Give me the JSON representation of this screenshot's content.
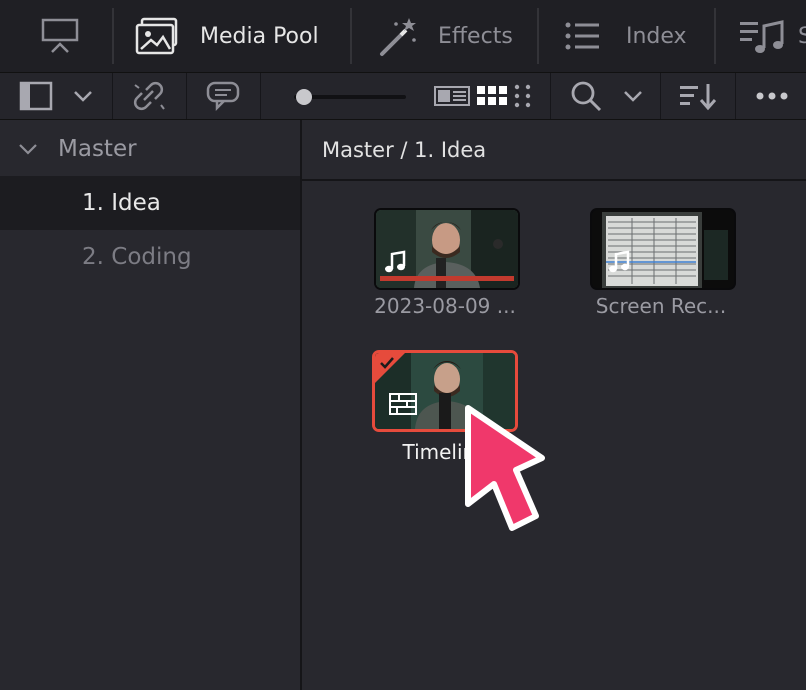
{
  "toolbar": {
    "tabs": [
      {
        "label": "Media Pool",
        "icon": "media-pool-icon"
      },
      {
        "label": "Effects",
        "icon": "effects-wand-icon"
      },
      {
        "label": "Index",
        "icon": "index-list-icon"
      },
      {
        "label": "S",
        "icon": "sound-library-icon"
      }
    ],
    "accent": "#e64b3c"
  },
  "sidebar": {
    "root": {
      "label": "Master",
      "icon": "chevron-down-icon"
    },
    "bins": [
      {
        "label": "1. Idea",
        "selected": true
      },
      {
        "label": "2. Coding",
        "selected": false
      }
    ]
  },
  "main": {
    "breadcrumb": "Master / 1. Idea",
    "clips": [
      {
        "label": "2023-08-09 ...",
        "type": "audio-video",
        "icon": "music-note-icon"
      },
      {
        "label": "Screen Rec...",
        "type": "audio-video",
        "icon": "music-note-icon"
      },
      {
        "label": "Timeline",
        "type": "timeline",
        "icon": "timeline-icon",
        "selected": true
      }
    ]
  },
  "overlay": {
    "pointer": "cursor-arrow-icon",
    "color": "#f0386b"
  }
}
